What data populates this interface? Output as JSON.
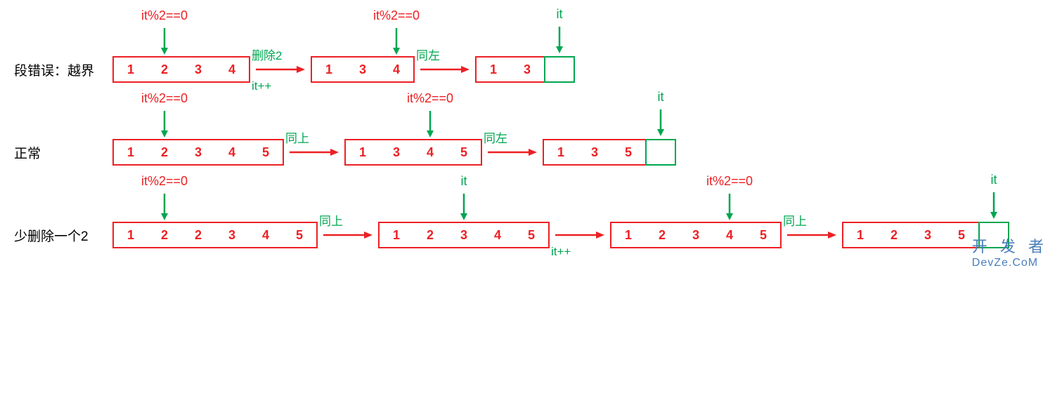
{
  "labels": {
    "cond": "it%2==0",
    "it": "it",
    "del2": "删除2",
    "itpp": "it++",
    "sameLeft": "同左",
    "sameUp": "同上"
  },
  "rows": {
    "r1": {
      "label": "段错误：越界"
    },
    "r2": {
      "label": "正常"
    },
    "r3": {
      "label": "少删除一个2"
    }
  },
  "arrays": {
    "r1a": [
      "1",
      "2",
      "3",
      "4"
    ],
    "r1b": [
      "1",
      "3",
      "4"
    ],
    "r1c": [
      "1",
      "3"
    ],
    "r2a": [
      "1",
      "2",
      "3",
      "4",
      "5"
    ],
    "r2b": [
      "1",
      "3",
      "4",
      "5"
    ],
    "r2c": [
      "1",
      "3",
      "5"
    ],
    "r3a": [
      "1",
      "2",
      "2",
      "3",
      "4",
      "5"
    ],
    "r3b": [
      "1",
      "2",
      "3",
      "4",
      "5"
    ],
    "r3c": [
      "1",
      "2",
      "3",
      "4",
      "5"
    ],
    "r3d": [
      "1",
      "2",
      "3",
      "5"
    ]
  },
  "watermark": {
    "l1": "开 发 者",
    "l2": "DevZe.CoM"
  }
}
